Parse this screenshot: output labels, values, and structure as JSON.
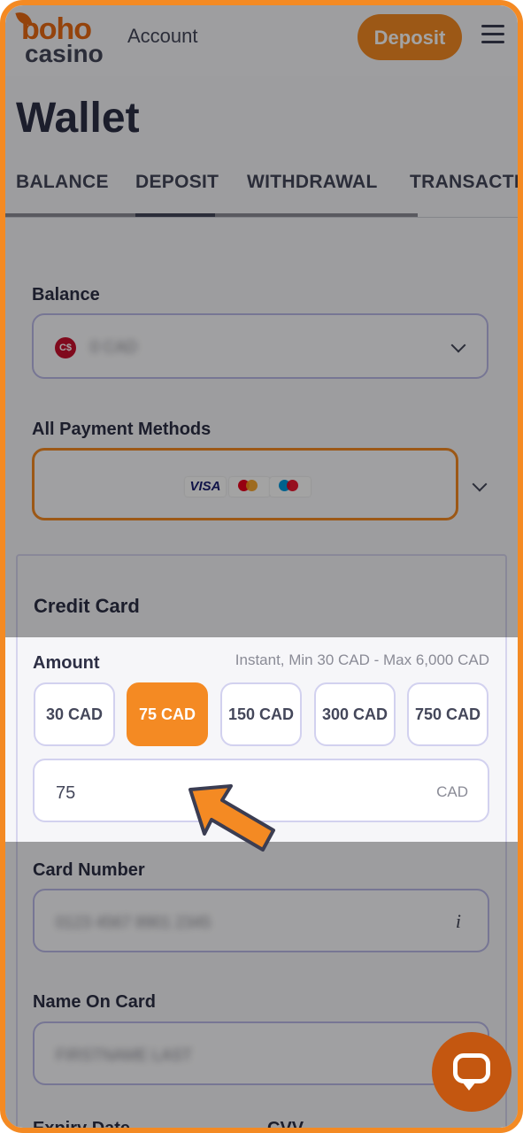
{
  "header": {
    "logo_top": "boho",
    "logo_bottom": "casino",
    "account_label": "Account",
    "deposit_label": "Deposit"
  },
  "page": {
    "title": "Wallet"
  },
  "tabs": [
    {
      "label": "BALANCE",
      "active": false
    },
    {
      "label": "DEPOSIT",
      "active": true
    },
    {
      "label": "WITHDRAWAL",
      "active": false
    },
    {
      "label": "TRANSACTIO",
      "active": false
    }
  ],
  "balance": {
    "label": "Balance",
    "currency_badge": "C$",
    "value_blurred": "0 CAD"
  },
  "payment_methods": {
    "label": "All Payment Methods",
    "logos": [
      "VISA",
      "mastercard",
      "maestro"
    ]
  },
  "credit_card": {
    "title": "Credit Card",
    "amount_label": "Amount",
    "amount_range": "Instant, Min 30 CAD - Max 6,000 CAD",
    "presets": [
      "30 CAD",
      "75 CAD",
      "150 CAD",
      "300 CAD",
      "750 CAD"
    ],
    "selected_preset_index": 1,
    "amount_value": "75",
    "amount_unit": "CAD",
    "card_number_label": "Card Number",
    "card_number_blurred": "0123 4567 8901 2345",
    "card_info_icon": "i",
    "name_label": "Name On Card",
    "name_blurred": "FIRSTNAME LAST",
    "expiry_label": "Expiry Date",
    "cvv_label": "CVV"
  },
  "colors": {
    "accent": "#f48a23",
    "chat": "#c45710"
  },
  "icons": [
    "hamburger-menu-icon",
    "chevron-down-icon",
    "info-icon",
    "chat-icon",
    "pointer-arrow-icon"
  ]
}
